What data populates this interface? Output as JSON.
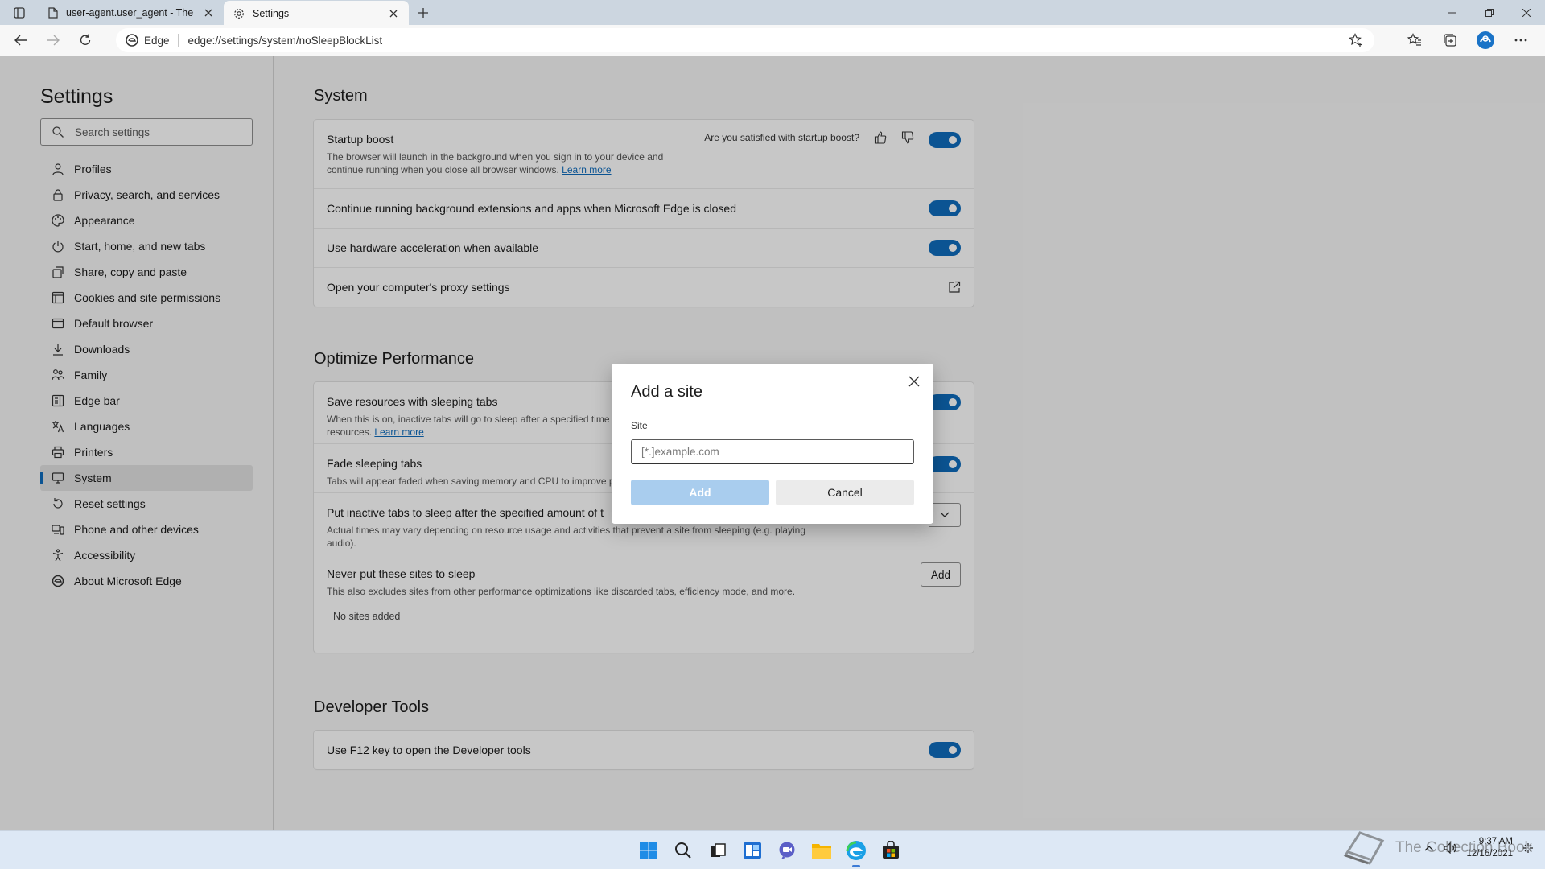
{
  "browser": {
    "tabs": [
      {
        "title": "user-agent.user_agent - The Coll",
        "active": false
      },
      {
        "title": "Settings",
        "active": true
      }
    ],
    "address": {
      "site_label": "Edge",
      "url": "edge://settings/system/noSleepBlockList"
    }
  },
  "sidebar": {
    "title": "Settings",
    "search_placeholder": "Search settings",
    "items": [
      {
        "label": "Profiles",
        "icon": "profile-icon"
      },
      {
        "label": "Privacy, search, and services",
        "icon": "lock-icon"
      },
      {
        "label": "Appearance",
        "icon": "palette-icon"
      },
      {
        "label": "Start, home, and new tabs",
        "icon": "power-icon"
      },
      {
        "label": "Share, copy and paste",
        "icon": "share-icon"
      },
      {
        "label": "Cookies and site permissions",
        "icon": "cookie-icon"
      },
      {
        "label": "Default browser",
        "icon": "browser-icon"
      },
      {
        "label": "Downloads",
        "icon": "download-icon"
      },
      {
        "label": "Family",
        "icon": "family-icon"
      },
      {
        "label": "Edge bar",
        "icon": "edgebar-icon"
      },
      {
        "label": "Languages",
        "icon": "languages-icon"
      },
      {
        "label": "Printers",
        "icon": "printer-icon"
      },
      {
        "label": "System",
        "icon": "system-icon",
        "selected": true
      },
      {
        "label": "Reset settings",
        "icon": "reset-icon"
      },
      {
        "label": "Phone and other devices",
        "icon": "phone-icon"
      },
      {
        "label": "Accessibility",
        "icon": "accessibility-icon"
      },
      {
        "label": "About Microsoft Edge",
        "icon": "edge-logo-icon"
      }
    ]
  },
  "system": {
    "title": "System",
    "startup_boost": {
      "title": "Startup boost",
      "desc_line1": "The browser will launch in the background when you sign in to your device and",
      "desc_line2": "continue running when you close all browser windows.",
      "learn_more": "Learn more",
      "feedback": "Are you satisfied with startup boost?",
      "enabled": true
    },
    "background_extensions": {
      "title": "Continue running background extensions and apps when Microsoft Edge is closed",
      "enabled": true
    },
    "hardware_accel": {
      "title": "Use hardware acceleration when available",
      "enabled": true
    },
    "proxy": {
      "title": "Open your computer's proxy settings"
    }
  },
  "performance": {
    "title": "Optimize Performance",
    "sleeping_tabs": {
      "title": "Save resources with sleeping tabs",
      "desc_line1": "When this is on, inactive tabs will go to sleep after a specified time",
      "desc_line2": "resources.",
      "learn_more": "Learn more",
      "enabled": true
    },
    "fade_tabs": {
      "title": "Fade sleeping tabs",
      "desc": "Tabs will appear faded when saving memory and CPU to improve p",
      "enabled": true
    },
    "inactive_sleep": {
      "title": "Put inactive tabs to sleep after the specified amount of t",
      "desc_line1": "Actual times may vary depending on resource usage and activities that prevent a site from sleeping (e.g. playing",
      "desc_line2": "audio)."
    },
    "never_sleep": {
      "title": "Never put these sites to sleep",
      "desc": "This also excludes sites from other performance optimizations like discarded tabs, efficiency mode, and more.",
      "add_label": "Add",
      "empty": "No sites added"
    }
  },
  "devtools": {
    "title": "Developer Tools",
    "f12": {
      "title": "Use F12 key to open the Developer tools",
      "enabled": true
    }
  },
  "dialog": {
    "title": "Add a site",
    "field_label": "Site",
    "placeholder": "[*.]example.com",
    "add_label": "Add",
    "cancel_label": "Cancel"
  },
  "taskbar": {
    "watermark": "The Collection Book",
    "time": "9:37 AM",
    "date": "12/16/2021"
  },
  "colors": {
    "accent": "#0f6cbd",
    "toggle_on": "#0f6cbd",
    "add_disabled": "#a9cdee"
  }
}
